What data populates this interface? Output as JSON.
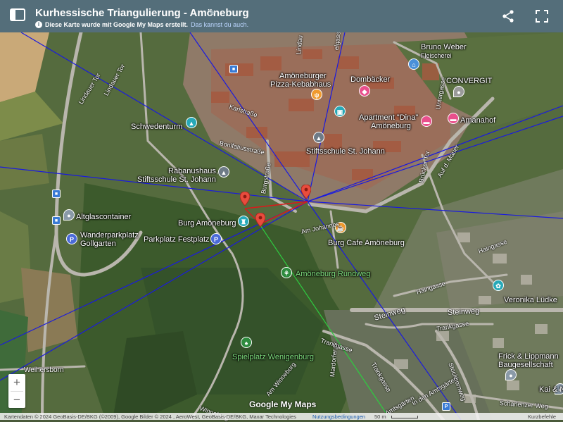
{
  "header": {
    "title": "Kurhessische Triangulierung - Amöneburg",
    "info_text": "Diese Karte wurde mit Google My Maps erstellt.",
    "info_link": "Das kannst du auch."
  },
  "colors": {
    "header_bg": "#546e7a",
    "line_blue": "#1a1adf",
    "line_red": "#d81b1b",
    "line_green": "#2ecc40"
  },
  "places": [
    {
      "id": "bruno-weber",
      "label": "Bruno Weber"
    },
    {
      "id": "fleischerei",
      "label": "Fleischerei"
    },
    {
      "id": "pizza-1",
      "label": "Amöneburger"
    },
    {
      "id": "pizza-2",
      "label": "Pizza-Kebabhaus"
    },
    {
      "id": "dombaecker",
      "label": "Dombäcker"
    },
    {
      "id": "convergit",
      "label": "CONVERGIT"
    },
    {
      "id": "apartment-1",
      "label": "Apartment \"Dina\""
    },
    {
      "id": "apartment-2",
      "label": "Amöneburg"
    },
    {
      "id": "amanahof",
      "label": "Amanahof"
    },
    {
      "id": "schwedenturm",
      "label": "Schwedenturm"
    },
    {
      "id": "stiftsschule",
      "label": "Stiftsschule St. Johann"
    },
    {
      "id": "rabanushaus-1",
      "label": "Rabanushaus,"
    },
    {
      "id": "rabanushaus-2",
      "label": "Stiftsschule St. Johann"
    },
    {
      "id": "altglas",
      "label": "Altglascontainer"
    },
    {
      "id": "wanderpark-1",
      "label": "Wanderparkplatz"
    },
    {
      "id": "wanderpark-2",
      "label": "Gollgarten"
    },
    {
      "id": "burg",
      "label": "Burg Amöneburg"
    },
    {
      "id": "festplatz",
      "label": "Parkplatz Festplatz"
    },
    {
      "id": "cafe",
      "label": "Burg Cafe Amöneburg"
    },
    {
      "id": "rundweg",
      "label": "Amöneburg Rundweg"
    },
    {
      "id": "veronika",
      "label": "Veronika Lüdke"
    },
    {
      "id": "spielplatz",
      "label": "Spielplatz Wenigenburg"
    },
    {
      "id": "frick-1",
      "label": "Frick & Lippmann"
    },
    {
      "id": "frick-2",
      "label": "Baugesellschaft"
    },
    {
      "id": "kai",
      "label": "Kai & N"
    }
  ],
  "streets": [
    {
      "id": "lindauer-tor",
      "label": "Lindauer Tor"
    },
    {
      "id": "lindauer-tor-2",
      "label": "Lindauer Tor"
    },
    {
      "id": "karlstrasse",
      "label": "Karlstraße"
    },
    {
      "id": "bonifatiusstrasse",
      "label": "Bonifatiusstraße"
    },
    {
      "id": "burgstrasse",
      "label": "Burgstraße"
    },
    {
      "id": "am-johannes",
      "label": "Am Johannes"
    },
    {
      "id": "bruecker-tor",
      "label": "Brücker Tor"
    },
    {
      "id": "auf-d-mauer",
      "label": "Auf d. Mauer"
    },
    {
      "id": "untergasse",
      "label": "Untergasse"
    },
    {
      "id": "haingasse",
      "label": "Haingasse"
    },
    {
      "id": "haingasse-2",
      "label": "Haingasse"
    },
    {
      "id": "steinweg",
      "label": "Steinweg"
    },
    {
      "id": "steinweg-2",
      "label": "Steinweg"
    },
    {
      "id": "trankgasse",
      "label": "Trankgasse"
    },
    {
      "id": "trankgasse-2",
      "label": "Trankgasse"
    },
    {
      "id": "trankgasse-3",
      "label": "Trankgasse"
    },
    {
      "id": "mardorfer",
      "label": "Mardorfer G."
    },
    {
      "id": "stockbornweg",
      "label": "Stockbornweg"
    },
    {
      "id": "in-den-amtsgaerten",
      "label": "In den Amtsgärten"
    },
    {
      "id": "amtsgarten-2",
      "label": "Amtsgärten"
    },
    {
      "id": "scharlenzer-weg",
      "label": "Scharlenzer Weg"
    },
    {
      "id": "weihersborn",
      "label": "Weihersborn"
    },
    {
      "id": "winneburg",
      "label": "Winneburg"
    },
    {
      "id": "am-winneburg",
      "label": "Am Winneburg"
    },
    {
      "id": "elgasse",
      "label": "elgasse"
    },
    {
      "id": "lindau-top",
      "label": "Lindau"
    }
  ],
  "footer": {
    "attribution": "Kartendaten © 2024 GeoBasis-DE/BKG (©2009), Google Bilder © 2024 , AeroWest, GeoBasis-DE/BKG, Maxar Technologies",
    "terms": "Nutzungsbedingungen",
    "scale": "50 m",
    "shortcuts": "Kurzbefehle",
    "logo": "Google My Maps"
  },
  "zoom": {
    "in": "+",
    "out": "−"
  }
}
